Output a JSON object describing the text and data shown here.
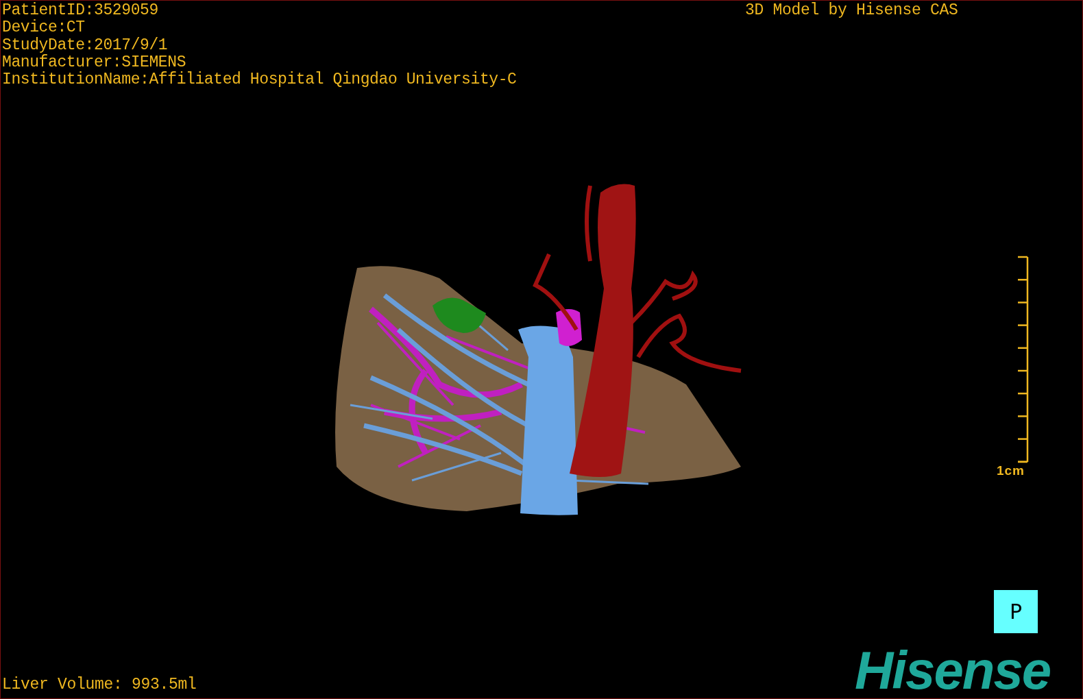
{
  "info_lines": [
    "PatientID:3529059",
    "Device:CT",
    "StudyDate:2017/9/1",
    "Manufacturer:SIEMENS",
    "InstitutionName:Affiliated Hospital Qingdao University-C"
  ],
  "title": "3D Model by Hisense CAS",
  "scale_bar": {
    "label": "1cm"
  },
  "view_button": {
    "label": "P"
  },
  "volume": "Liver Volume: 993.5ml",
  "logo": "Hisense"
}
